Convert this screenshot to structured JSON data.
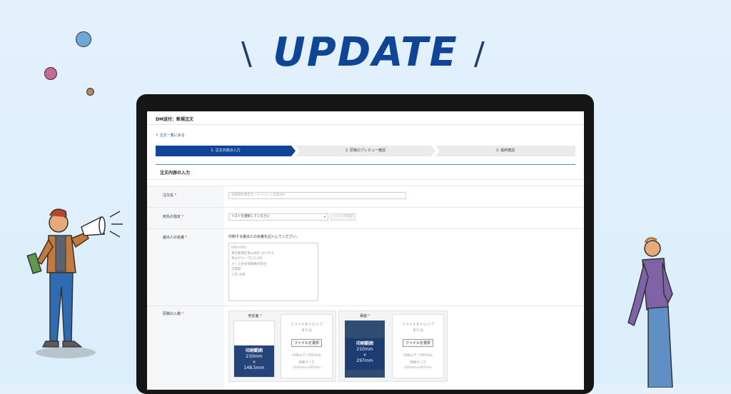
{
  "headline": {
    "left_slash": "\\",
    "title": "UPDATE",
    "right_slash": "/"
  },
  "app": {
    "page_title": "DM送付：新規注文",
    "back_link": "注文一覧に戻る",
    "steps": [
      "1. 注文内容の入力",
      "2. 原稿のプレビュー確認",
      "3. 最終確認"
    ],
    "active_step": 0,
    "section_title": "注文内容の入力",
    "fields": {
      "order_name": {
        "label": "注文名",
        "placeholder": "日曜特別限定セールイベント告知DM"
      },
      "destination": {
        "label": "宛先の指定",
        "selected": "リストを選択してください",
        "confirm_button": "リストの確認"
      },
      "sender": {
        "label": "差出人の名義",
        "note": "印刷する差出人の名義を記入してください。",
        "lines": [
          "000-0761",
          "東京都港区青山台町 20-70-2",
          "青山グループビル10F",
          "さくら生命保険株式会社",
          "営業部",
          "三宅 太郎"
        ]
      },
      "manuscript": {
        "label": "原稿の入稿",
        "front": {
          "title": "宛名面",
          "badge_title": "印刷範囲",
          "size1": "210mm",
          "times": "×",
          "size2": "148.5mm"
        },
        "back": {
          "title": "裏面",
          "badge_title": "印刷範囲",
          "size1": "210mm",
          "times": "×",
          "size2": "297mm"
        },
        "drop": {
          "line1": "ファイルをドロップ",
          "line2": "または",
          "button": "ファイルを選択",
          "limit": "5MB以下 / PDFのみ",
          "size_label": "原稿サイズ",
          "size_front": "210mm×297mm",
          "size_back": "210mm×297mm"
        }
      }
    }
  },
  "colors": {
    "brand": "#0f4596",
    "required": "#d9302c"
  }
}
